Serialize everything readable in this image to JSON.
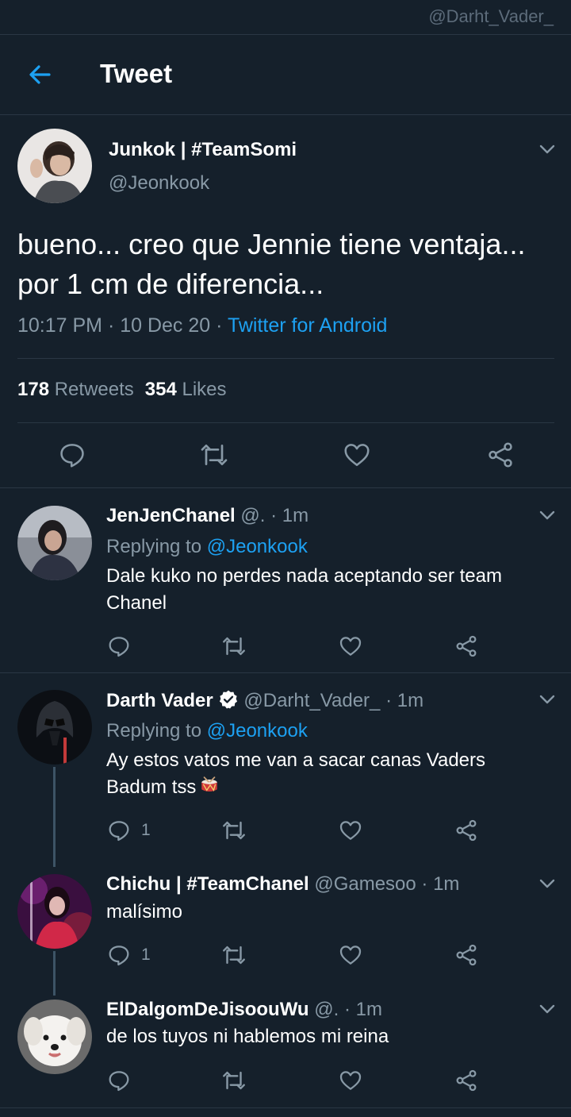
{
  "watermark": "@Darht_Vader_",
  "header": {
    "title": "Tweet",
    "back_icon": "arrow-left-icon"
  },
  "main_tweet": {
    "name": "Junkok | #TeamSomi",
    "handle": "@Jeonkook",
    "text": "bueno... creo que Jennie tiene ventaja... por 1 cm de diferencia...",
    "time": "10:17 PM · 10 Dec 20 · ",
    "source": "Twitter for Android",
    "retweets_count": "178",
    "retweets_label": "Retweets",
    "likes_count": "354",
    "likes_label": "Likes"
  },
  "replies": [
    {
      "name": "JenJenChanel",
      "meta": " @. · 1m",
      "replying_prefix": "Replying to ",
      "replying_to": "@Jeonkook",
      "text": "Dale kuko no perdes nada aceptando ser team Chanel",
      "reply_count": ""
    },
    {
      "name": "Darth Vader",
      "verified": true,
      "meta": " @Darht_Vader_ · 1m",
      "replying_prefix": "Replying to ",
      "replying_to": "@Jeonkook",
      "text": "Ay estos vatos me van a sacar canas Vaders Badum tss",
      "emoji": "drum-icon",
      "reply_count": "1"
    },
    {
      "name": "Chichu | #TeamChanel",
      "meta": " @Gamesoo · 1m",
      "text": "malísimo",
      "reply_count": "1"
    },
    {
      "name": "ElDalgomDeJisoouWu",
      "meta": " @. · 1m",
      "text": "de los tuyos ni hablemos mi reina",
      "reply_count": ""
    }
  ],
  "colors": {
    "background": "#15202b",
    "accent": "#1da1f2",
    "muted": "#8899a6",
    "divider": "#2a3744"
  }
}
